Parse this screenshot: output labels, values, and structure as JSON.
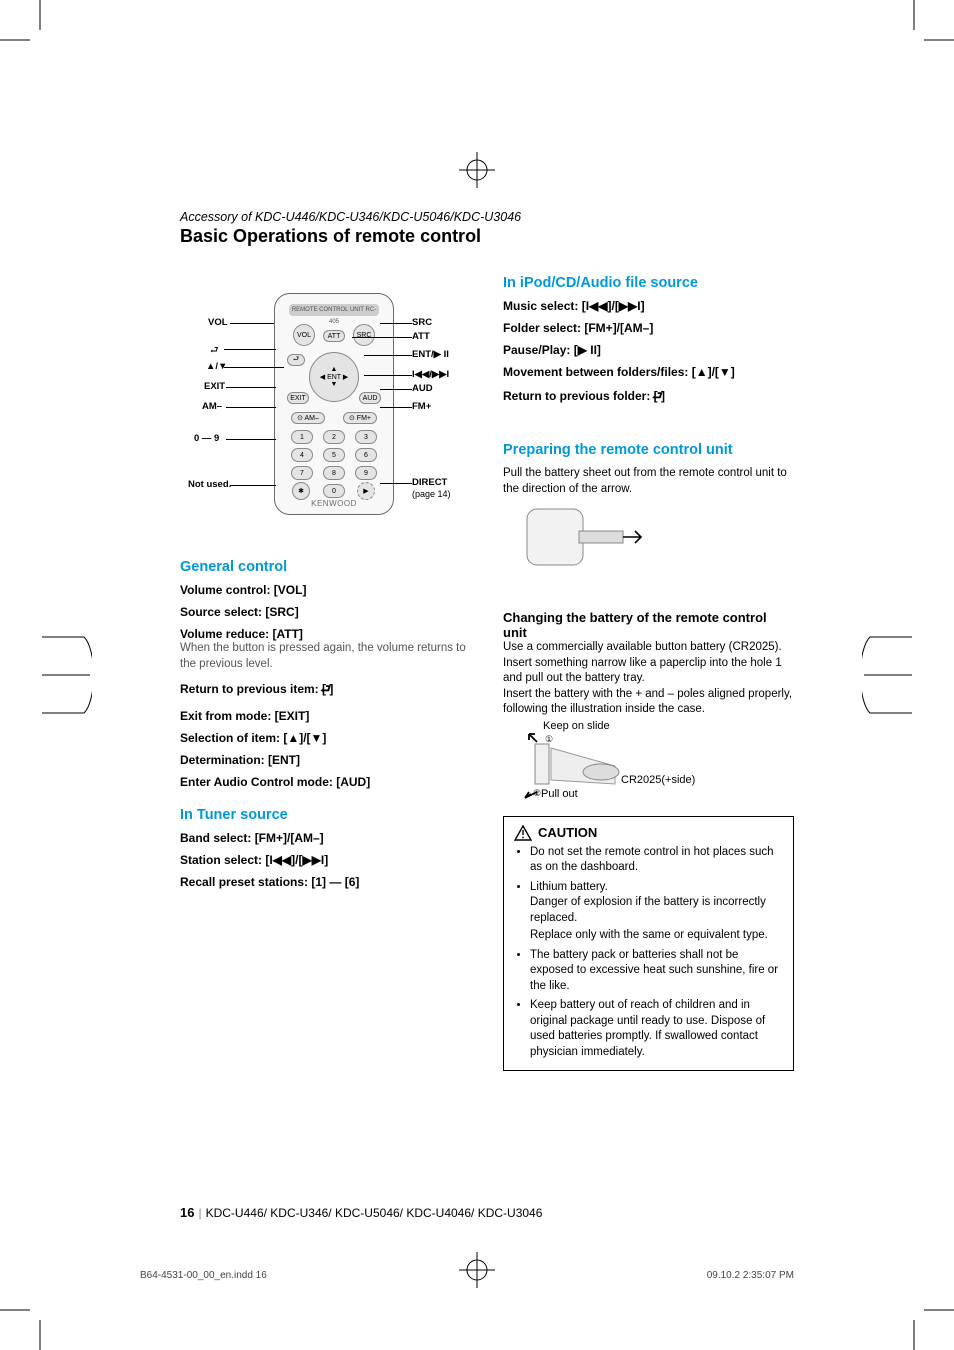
{
  "header": {
    "accessory": "Accessory of KDC-U446/KDC-U346/KDC-U5046/KDC-U3046",
    "title": "Basic Operations of remote control"
  },
  "diagram": {
    "screen": "REMOTE CONTROL UNIT RC-405",
    "labels": {
      "vol": "VOL",
      "src": "SRC",
      "att": "ATT",
      "ent": "ENT/▶ II",
      "up_down": "▲/▼",
      "skip": "I◀◀/▶▶I",
      "exit": "EXIT",
      "aud": "AUD",
      "am_minus": "AM–",
      "fm_plus": "FM+",
      "nums": "0 — 9",
      "not_used": "Not used.",
      "direct": "DIRECT",
      "direct_page": "(page 14)"
    },
    "logo": "KENWOOD"
  },
  "general": {
    "heading": "General control",
    "volume": "Volume control: [VOL]",
    "source": "Source select: [SRC]",
    "reduce_label": "Volume reduce: [ATT]",
    "reduce_note": "When the button is pressed again, the volume returns to the previous level.",
    "return_item": "Return to previous item: [   ]",
    "exit": "Exit from mode: [EXIT]",
    "selection": "Selection of item: [▲]/[▼]",
    "determination": "Determination: [ENT]",
    "audio_mode": "Enter Audio Control mode: [AUD]"
  },
  "tuner": {
    "heading": "In Tuner source",
    "band": "Band select: [FM+]/[AM–]",
    "station": "Station select: [I◀◀]/[▶▶I]",
    "recall": "Recall preset stations: [1] — [6]"
  },
  "ipod": {
    "heading": "In iPod/CD/Audio file source",
    "music": "Music select: [I◀◀]/[▶▶I]",
    "folder": "Folder select: [FM+]/[AM–]",
    "pause": "Pause/Play: [▶ II]",
    "movement": "Movement between folders/files: [▲]/[▼]",
    "return_folder": "Return to previous folder: [   ]"
  },
  "prepare": {
    "heading": "Preparing the remote control unit",
    "body": "Pull the battery sheet out from the remote control unit to the direction of the arrow."
  },
  "battery": {
    "heading": "Changing the battery of the remote control unit",
    "body1": "Use a commercially available button battery (CR2025). Insert something narrow like a paperclip into the hole 1 and pull out the battery tray.",
    "body2": "Insert the battery with the + and – poles aligned properly, following the illustration inside the case.",
    "keep": "Keep on slide",
    "pull": "Pull out",
    "part": "CR2025(+side)"
  },
  "caution": {
    "title": "CAUTION",
    "hot": "Do not set the remote control in hot places such as on the dashboard.",
    "lithium_label": "Lithium battery.",
    "lithium_body": "Danger of explosion if the battery is incorrectly replaced.",
    "lithium_body2": "Replace only with the same or equivalent type.",
    "heat": "The battery pack or batteries shall not be exposed to excessive heat such sunshine, fire or the like.",
    "children": "Keep battery out of reach of children and in original package until ready to use. Dispose of used batteries promptly. If swallowed contact physician immediately."
  },
  "footer": {
    "pagenum": "16",
    "models": "KDC-U446/ KDC-U346/ KDC-U5046/ KDC-U4046/ KDC-U3046",
    "indd": "B64-4531-00_00_en.indd   16",
    "timestamp": "09.10.2   2:35:07 PM"
  }
}
